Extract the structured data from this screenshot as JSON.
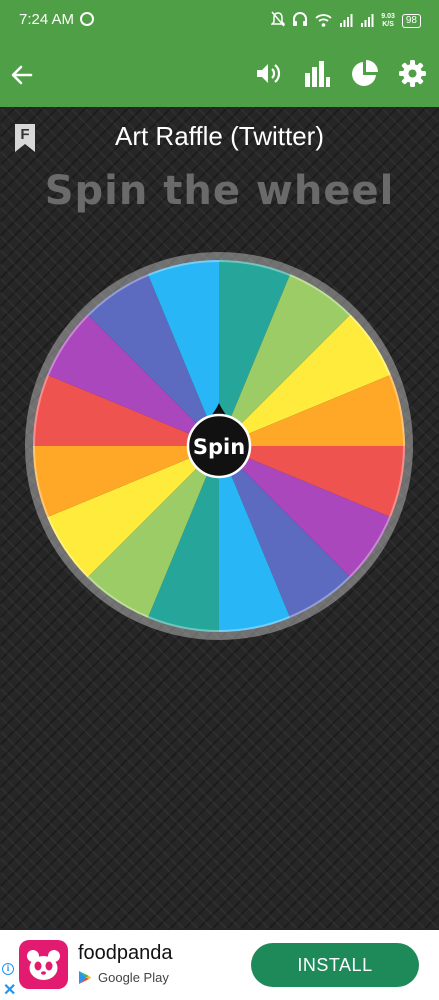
{
  "status_bar": {
    "time": "7:24 AM",
    "net_speed_value": "9.03",
    "net_speed_unit": "K/S",
    "battery": "98",
    "icons": [
      "messenger-icon",
      "mute-icon",
      "headphones-icon",
      "wifi-icon",
      "signal-icon",
      "signal-icon",
      "battery-icon"
    ]
  },
  "app_bar": {
    "icons": [
      "back-arrow-icon",
      "volume-icon",
      "stats-bar-chart-icon",
      "pie-chart-icon",
      "settings-gear-icon"
    ],
    "color": "#4e9f45"
  },
  "main": {
    "badge_letter": "F",
    "title": "Art Raffle (Twitter)",
    "subtitle": "Spin the wheel",
    "spin_label": "Spin",
    "wheel_colors": [
      "#26a69a",
      "#9ccc65",
      "#ffeb3b",
      "#ffa726",
      "#ef5350",
      "#ab47bc",
      "#5c6bc0",
      "#29b6f6",
      "#26a69a",
      "#9ccc65",
      "#ffeb3b",
      "#ffa726",
      "#ef5350",
      "#ab47bc",
      "#5c6bc0",
      "#29b6f6"
    ]
  },
  "ad": {
    "app_name": "foodpanda",
    "store": "Google Play",
    "install_label": "INSTALL",
    "info_glyph": "i",
    "close_glyph": "✕",
    "button_color": "#1e8a5a"
  }
}
